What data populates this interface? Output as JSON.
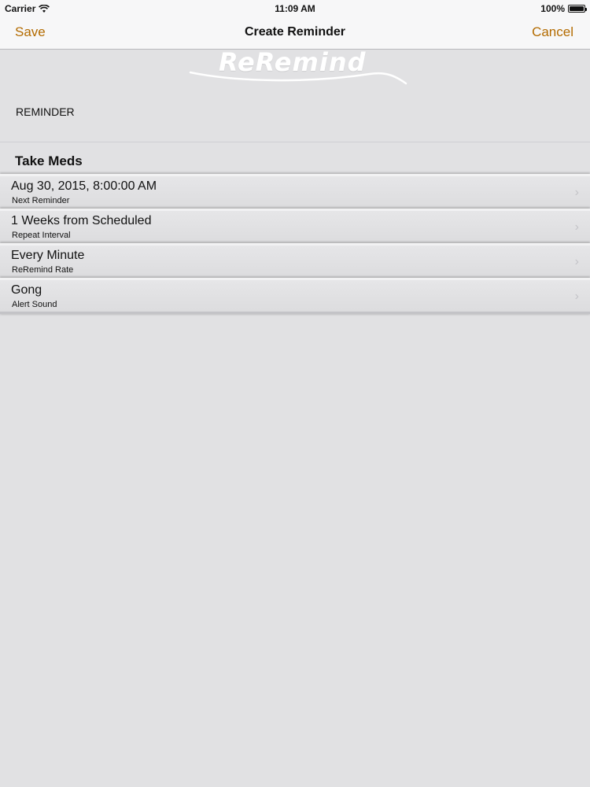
{
  "status_bar": {
    "carrier": "Carrier",
    "wifi_icon": "wifi-icon",
    "time": "11:09 AM",
    "battery": "100%",
    "battery_icon": "battery-icon"
  },
  "nav": {
    "save_label": "Save",
    "title": "Create Reminder",
    "cancel_label": "Cancel",
    "accent_color": "#b36b00"
  },
  "logo": {
    "text": "ReRemind"
  },
  "section": {
    "label": "REMINDER",
    "reminder_name": "Take Meds"
  },
  "cells": [
    {
      "value": "Aug 30, 2015, 8:00:00 AM",
      "label": "Next Reminder"
    },
    {
      "value": "1 Weeks from Scheduled",
      "label": "Repeat Interval"
    },
    {
      "value": "Every Minute",
      "label": "ReRemind Rate"
    },
    {
      "value": "Gong",
      "label": "Alert Sound"
    }
  ],
  "chevron_icon": "chevron-right-icon"
}
